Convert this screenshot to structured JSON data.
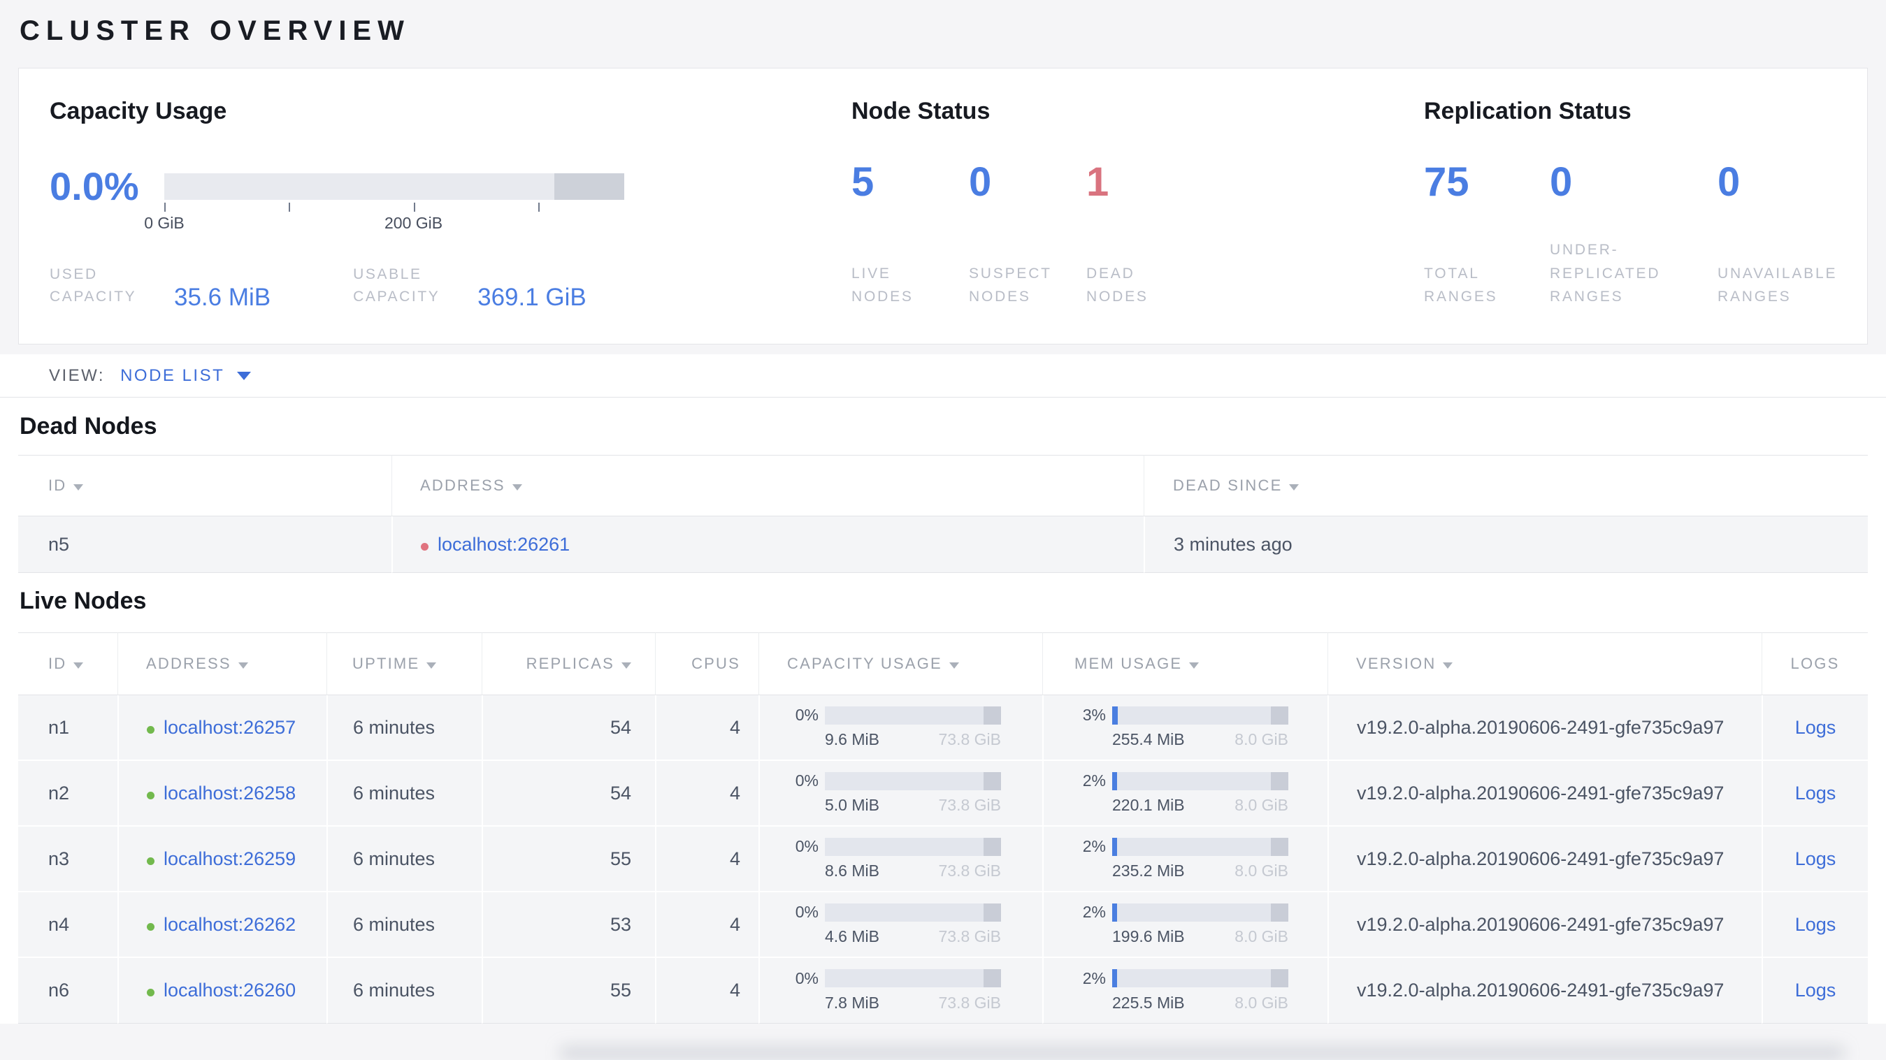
{
  "page_title": "CLUSTER OVERVIEW",
  "colors": {
    "accent_blue": "#4a7de2",
    "link_blue": "#3d6dd8",
    "danger_red": "#d9737f",
    "dot_green": "#72b94d",
    "dot_red": "#e0737f",
    "mem_fill_blue": "#4a7ee0"
  },
  "summary": {
    "capacity": {
      "title": "Capacity Usage",
      "percent": "0.0%",
      "gauge": {
        "type": "bar",
        "total_gib": 369.1,
        "ticks_gib": [
          0,
          100,
          200,
          300
        ],
        "tick_labels": {
          "0": "0 GiB",
          "200": "200 GiB"
        },
        "reserved_start_frac": 0.848
      },
      "stats": [
        {
          "label": "USED\nCAPACITY",
          "value": "35.6 MiB"
        },
        {
          "label": "USABLE\nCAPACITY",
          "value": "369.1 GiB"
        }
      ]
    },
    "node_status": {
      "title": "Node Status",
      "stats": [
        {
          "value": "5",
          "label": "LIVE\nNODES"
        },
        {
          "value": "0",
          "label": "SUSPECT\nNODES"
        },
        {
          "value": "1",
          "label": "DEAD\nNODES"
        }
      ]
    },
    "replication": {
      "title": "Replication Status",
      "stats": [
        {
          "value": "75",
          "label": "TOTAL\nRANGES"
        },
        {
          "value": "0",
          "label": "UNDER-\nREPLICATED\nRANGES"
        },
        {
          "value": "0",
          "label": "UNAVAILABLE\nRANGES"
        }
      ]
    }
  },
  "view_bar": {
    "label": "VIEW:",
    "selected": "NODE LIST"
  },
  "dead_nodes": {
    "title": "Dead Nodes",
    "columns": [
      {
        "label": "ID",
        "sortable": true
      },
      {
        "label": "ADDRESS",
        "sortable": true
      },
      {
        "label": "DEAD SINCE",
        "sortable": true
      }
    ],
    "rows": [
      {
        "id": "n5",
        "address": "localhost:26261",
        "dead_since": "3 minutes ago"
      }
    ]
  },
  "live_nodes": {
    "title": "Live Nodes",
    "columns": [
      {
        "label": "ID",
        "sortable": true
      },
      {
        "label": "ADDRESS",
        "sortable": true
      },
      {
        "label": "UPTIME",
        "sortable": true
      },
      {
        "label": "REPLICAS",
        "sortable": true
      },
      {
        "label": "CPUS",
        "sortable": false
      },
      {
        "label": "CAPACITY USAGE",
        "sortable": true
      },
      {
        "label": "MEM USAGE",
        "sortable": true
      },
      {
        "label": "VERSION",
        "sortable": true
      },
      {
        "label": "LOGS",
        "sortable": false
      }
    ],
    "rows": [
      {
        "id": "n1",
        "address": "localhost:26257",
        "uptime": "6 minutes",
        "replicas": "54",
        "cpus": "4",
        "capacity": {
          "percent": "0%",
          "fill_pct": 0,
          "used": "9.6 MiB",
          "total": "73.8 GiB"
        },
        "mem": {
          "percent": "3%",
          "fill_pct": 3,
          "used": "255.4 MiB",
          "total": "8.0 GiB"
        },
        "version": "v19.2.0-alpha.20190606-2491-gfe735c9a97",
        "logs_label": "Logs"
      },
      {
        "id": "n2",
        "address": "localhost:26258",
        "uptime": "6 minutes",
        "replicas": "54",
        "cpus": "4",
        "capacity": {
          "percent": "0%",
          "fill_pct": 0,
          "used": "5.0 MiB",
          "total": "73.8 GiB"
        },
        "mem": {
          "percent": "2%",
          "fill_pct": 2,
          "used": "220.1 MiB",
          "total": "8.0 GiB"
        },
        "version": "v19.2.0-alpha.20190606-2491-gfe735c9a97",
        "logs_label": "Logs"
      },
      {
        "id": "n3",
        "address": "localhost:26259",
        "uptime": "6 minutes",
        "replicas": "55",
        "cpus": "4",
        "capacity": {
          "percent": "0%",
          "fill_pct": 0,
          "used": "8.6 MiB",
          "total": "73.8 GiB"
        },
        "mem": {
          "percent": "2%",
          "fill_pct": 2,
          "used": "235.2 MiB",
          "total": "8.0 GiB"
        },
        "version": "v19.2.0-alpha.20190606-2491-gfe735c9a97",
        "logs_label": "Logs"
      },
      {
        "id": "n4",
        "address": "localhost:26262",
        "uptime": "6 minutes",
        "replicas": "53",
        "cpus": "4",
        "capacity": {
          "percent": "0%",
          "fill_pct": 0,
          "used": "4.6 MiB",
          "total": "73.8 GiB"
        },
        "mem": {
          "percent": "2%",
          "fill_pct": 2,
          "used": "199.6 MiB",
          "total": "8.0 GiB"
        },
        "version": "v19.2.0-alpha.20190606-2491-gfe735c9a97",
        "logs_label": "Logs"
      },
      {
        "id": "n6",
        "address": "localhost:26260",
        "uptime": "6 minutes",
        "replicas": "55",
        "cpus": "4",
        "capacity": {
          "percent": "0%",
          "fill_pct": 0,
          "used": "7.8 MiB",
          "total": "73.8 GiB"
        },
        "mem": {
          "percent": "2%",
          "fill_pct": 2,
          "used": "225.5 MiB",
          "total": "8.0 GiB"
        },
        "version": "v19.2.0-alpha.20190606-2491-gfe735c9a97",
        "logs_label": "Logs"
      }
    ]
  }
}
